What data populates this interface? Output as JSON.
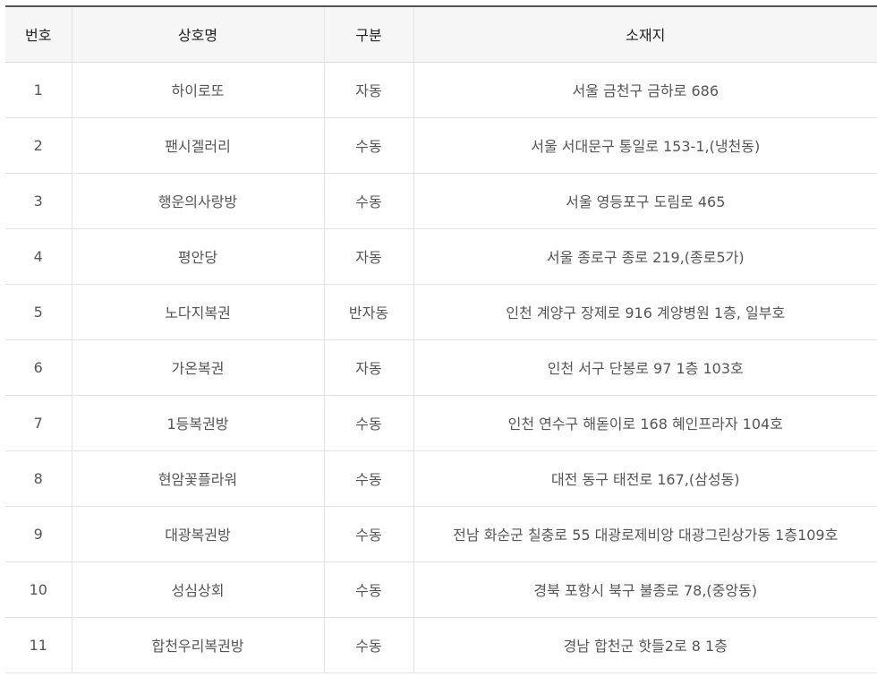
{
  "table": {
    "headers": {
      "no": "번호",
      "name": "상호명",
      "type": "구분",
      "address": "소재지"
    },
    "rows": [
      {
        "no": "1",
        "name": "하이로또",
        "type": "자동",
        "address": "서울 금천구 금하로 686"
      },
      {
        "no": "2",
        "name": "팬시겔러리",
        "type": "수동",
        "address": "서울 서대문구 통일로 153-1,(냉천동)"
      },
      {
        "no": "3",
        "name": "행운의사랑방",
        "type": "수동",
        "address": "서울 영등포구 도림로 465"
      },
      {
        "no": "4",
        "name": "평안당",
        "type": "자동",
        "address": "서울 종로구 종로 219,(종로5가)"
      },
      {
        "no": "5",
        "name": "노다지복권",
        "type": "반자동",
        "address": "인천 계양구 장제로 916 계양병원 1층, 일부호"
      },
      {
        "no": "6",
        "name": "가온복권",
        "type": "자동",
        "address": "인천 서구 단봉로 97 1층 103호"
      },
      {
        "no": "7",
        "name": "1등복권방",
        "type": "수동",
        "address": "인천 연수구 해돋이로 168 혜인프라자 104호"
      },
      {
        "no": "8",
        "name": "현암꽃플라워",
        "type": "수동",
        "address": "대전 동구 태전로 167,(삼성동)"
      },
      {
        "no": "9",
        "name": "대광복권방",
        "type": "수동",
        "address": "전남 화순군 칠충로 55 대광로제비앙 대광그린상가동 1층109호"
      },
      {
        "no": "10",
        "name": "성심상회",
        "type": "수동",
        "address": "경북 포항시 북구 불종로 78,(중앙동)"
      },
      {
        "no": "11",
        "name": "합천우리복권방",
        "type": "수동",
        "address": "경남 합천군 핫들2로 8 1층"
      }
    ]
  }
}
